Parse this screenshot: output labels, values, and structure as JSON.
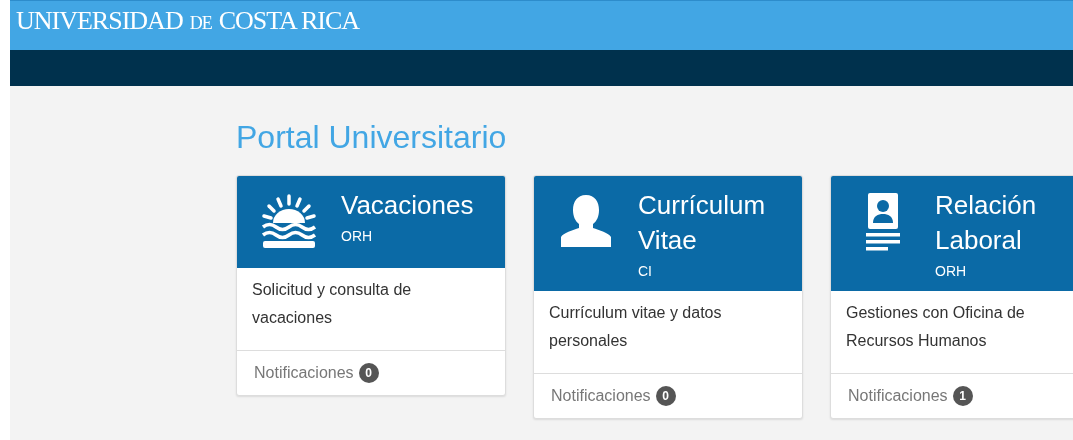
{
  "header": {
    "logo": [
      "UNIVERSIDAD",
      "DE",
      "COSTA RICA"
    ]
  },
  "page": {
    "title": "Portal Universitario"
  },
  "cards": [
    {
      "kind": "sun",
      "title": [
        "Vacaciones"
      ],
      "unit": "ORH",
      "description": "Solicitud y consulta de vacaciones",
      "footer": "Notificaciones",
      "count": "0"
    },
    {
      "kind": "person",
      "title": [
        "Currículum",
        "Vitae"
      ],
      "unit": "CI",
      "description": "Currículum vitae y datos personales",
      "footer": "Notificaciones",
      "count": "0"
    },
    {
      "kind": "idcard",
      "title": [
        "Relación",
        "Laboral"
      ],
      "unit": "ORH",
      "description": "Gestiones con Oficina de Recursos Humanos",
      "footer": "Notificaciones",
      "count": "1"
    }
  ]
}
